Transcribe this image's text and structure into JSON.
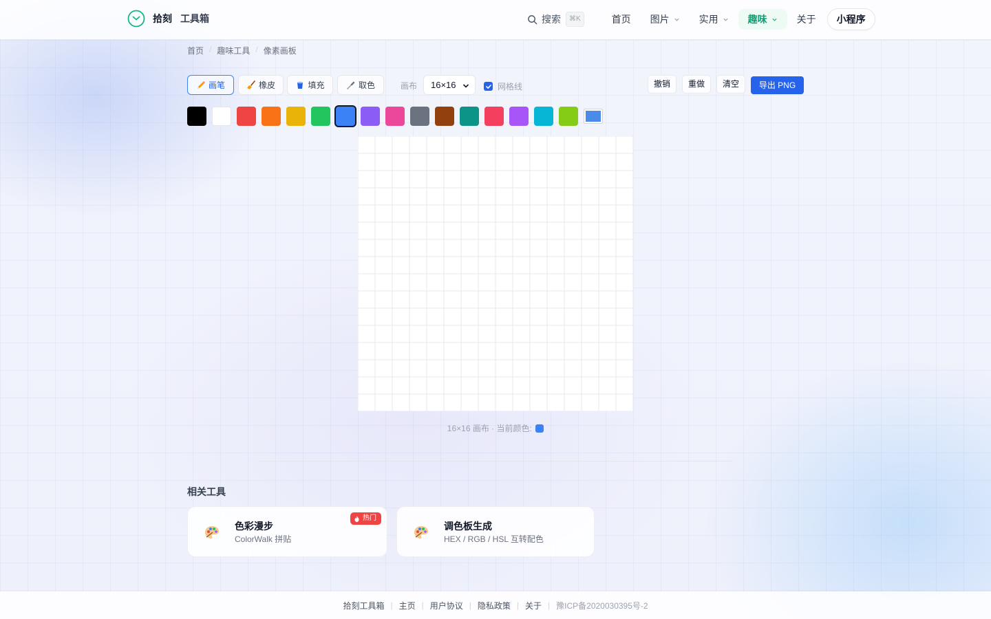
{
  "brand": {
    "name": "拾刻",
    "subtitle": "工具箱",
    "accent": "#10b981"
  },
  "header": {
    "search_label": "搜索",
    "search_shortcut": "⌘K",
    "nav": [
      {
        "label": "首页",
        "has_dropdown": false,
        "active": false
      },
      {
        "label": "图片",
        "has_dropdown": true,
        "active": false
      },
      {
        "label": "实用",
        "has_dropdown": true,
        "active": false
      },
      {
        "label": "趣味",
        "has_dropdown": true,
        "active": true
      },
      {
        "label": "关于",
        "has_dropdown": false,
        "active": false
      }
    ],
    "miniprogram_label": "小程序"
  },
  "breadcrumb": [
    "首页",
    "趣味工具",
    "像素画板"
  ],
  "toolbar": {
    "tools": [
      {
        "label": "画笔",
        "icon": "pencil-icon",
        "active": true
      },
      {
        "label": "橡皮",
        "icon": "broom-icon",
        "active": false
      },
      {
        "label": "填充",
        "icon": "bucket-icon",
        "active": false
      },
      {
        "label": "取色",
        "icon": "eyedropper-icon",
        "active": false
      }
    ],
    "canvas_label": "画布",
    "canvas_size": "16×16",
    "gridlines_label": "网格线",
    "gridlines_checked": true,
    "undo_label": "撤销",
    "redo_label": "重做",
    "clear_label": "清空",
    "export_label": "导出 PNG"
  },
  "palette": {
    "colors": [
      "#000000",
      "#ffffff",
      "#ef4444",
      "#f97316",
      "#eab308",
      "#22c55e",
      "#3b82f6",
      "#8b5cf6",
      "#ec4899",
      "#6b7280",
      "#92400e",
      "#0d9488",
      "#f43f5e",
      "#a855f7",
      "#06b6d4",
      "#84cc16"
    ],
    "selected": "#3b82f6",
    "custom_color": "#4a8ae8"
  },
  "canvas": {
    "cols": 16,
    "rows": 16,
    "gridlines": true
  },
  "status": {
    "text": "16×16 画布 · 当前颜色:",
    "color": "#3b82f6"
  },
  "related": {
    "title": "相关工具",
    "cards": [
      {
        "title": "色彩漫步",
        "subtitle": "ColorWalk 拼贴",
        "icon": "palette-icon",
        "badge": "热门"
      },
      {
        "title": "调色板生成",
        "subtitle": "HEX / RGB / HSL 互转配色",
        "icon": "palette-icon",
        "badge": ""
      }
    ]
  },
  "footer": {
    "links": [
      "拾刻工具箱",
      "主页",
      "用户协议",
      "隐私政策",
      "关于"
    ],
    "icp": "豫ICP备2020030395号-2"
  }
}
